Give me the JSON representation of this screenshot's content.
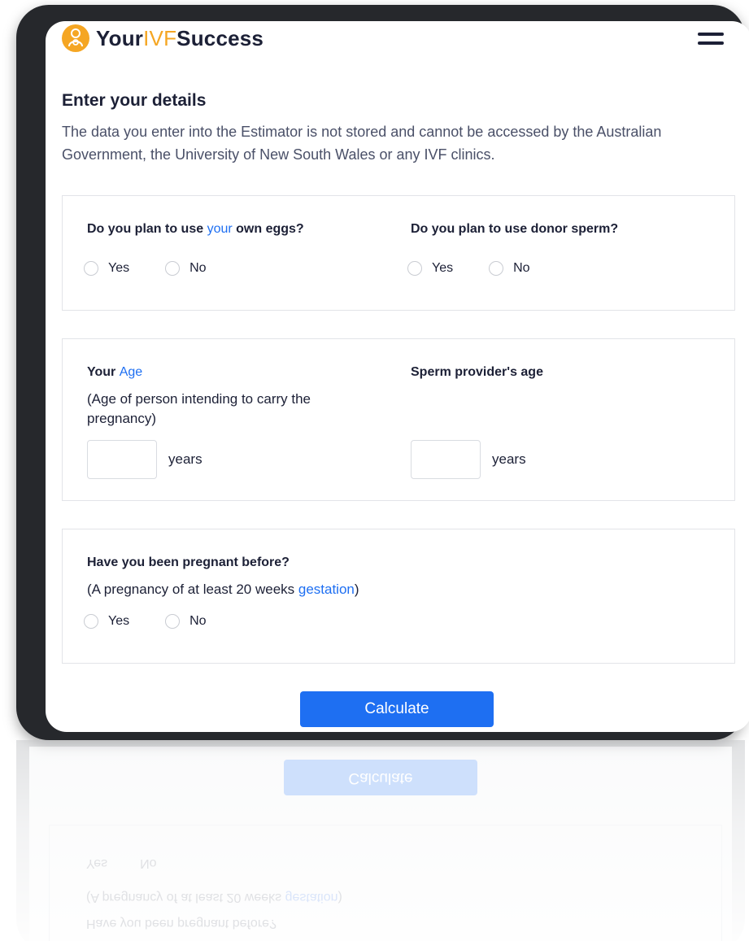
{
  "header": {
    "logo_part1": "Your",
    "logo_part2": "IVF",
    "logo_part3": "Success",
    "logo_icon": "mother-child-icon",
    "menu_icon": "hamburger-menu-icon"
  },
  "page": {
    "title": "Enter your details",
    "intro": "The data you enter into the Estimator is not stored and cannot be accessed by the Australian Government, the University of New South Wales or any IVF clinics."
  },
  "eggs_question": {
    "prefix": "Do you plan to use ",
    "link": "your",
    "suffix": " own eggs?",
    "options": [
      "Yes",
      "No"
    ]
  },
  "sperm_question": {
    "label": "Do you plan to use donor sperm?",
    "options": [
      "Yes",
      "No"
    ]
  },
  "age": {
    "label_prefix": "Your ",
    "label_link": "Age",
    "sub": "(Age of person intending to carry the pregnancy)",
    "input_value": "",
    "unit": "years"
  },
  "sperm_age": {
    "label": "Sperm provider's age",
    "input_value": "",
    "unit": "years"
  },
  "pregnant_question": {
    "label": "Have you been pregnant before?",
    "sub_prefix": "(A pregnancy of at least 20 weeks ",
    "sub_link": "gestation",
    "sub_suffix": ")",
    "options": [
      "Yes",
      "No"
    ]
  },
  "actions": {
    "calculate_label": "Calculate"
  },
  "colors": {
    "accent_blue": "#1e6ff2",
    "logo_orange": "#f5a623",
    "text_dark": "#1c2036"
  }
}
